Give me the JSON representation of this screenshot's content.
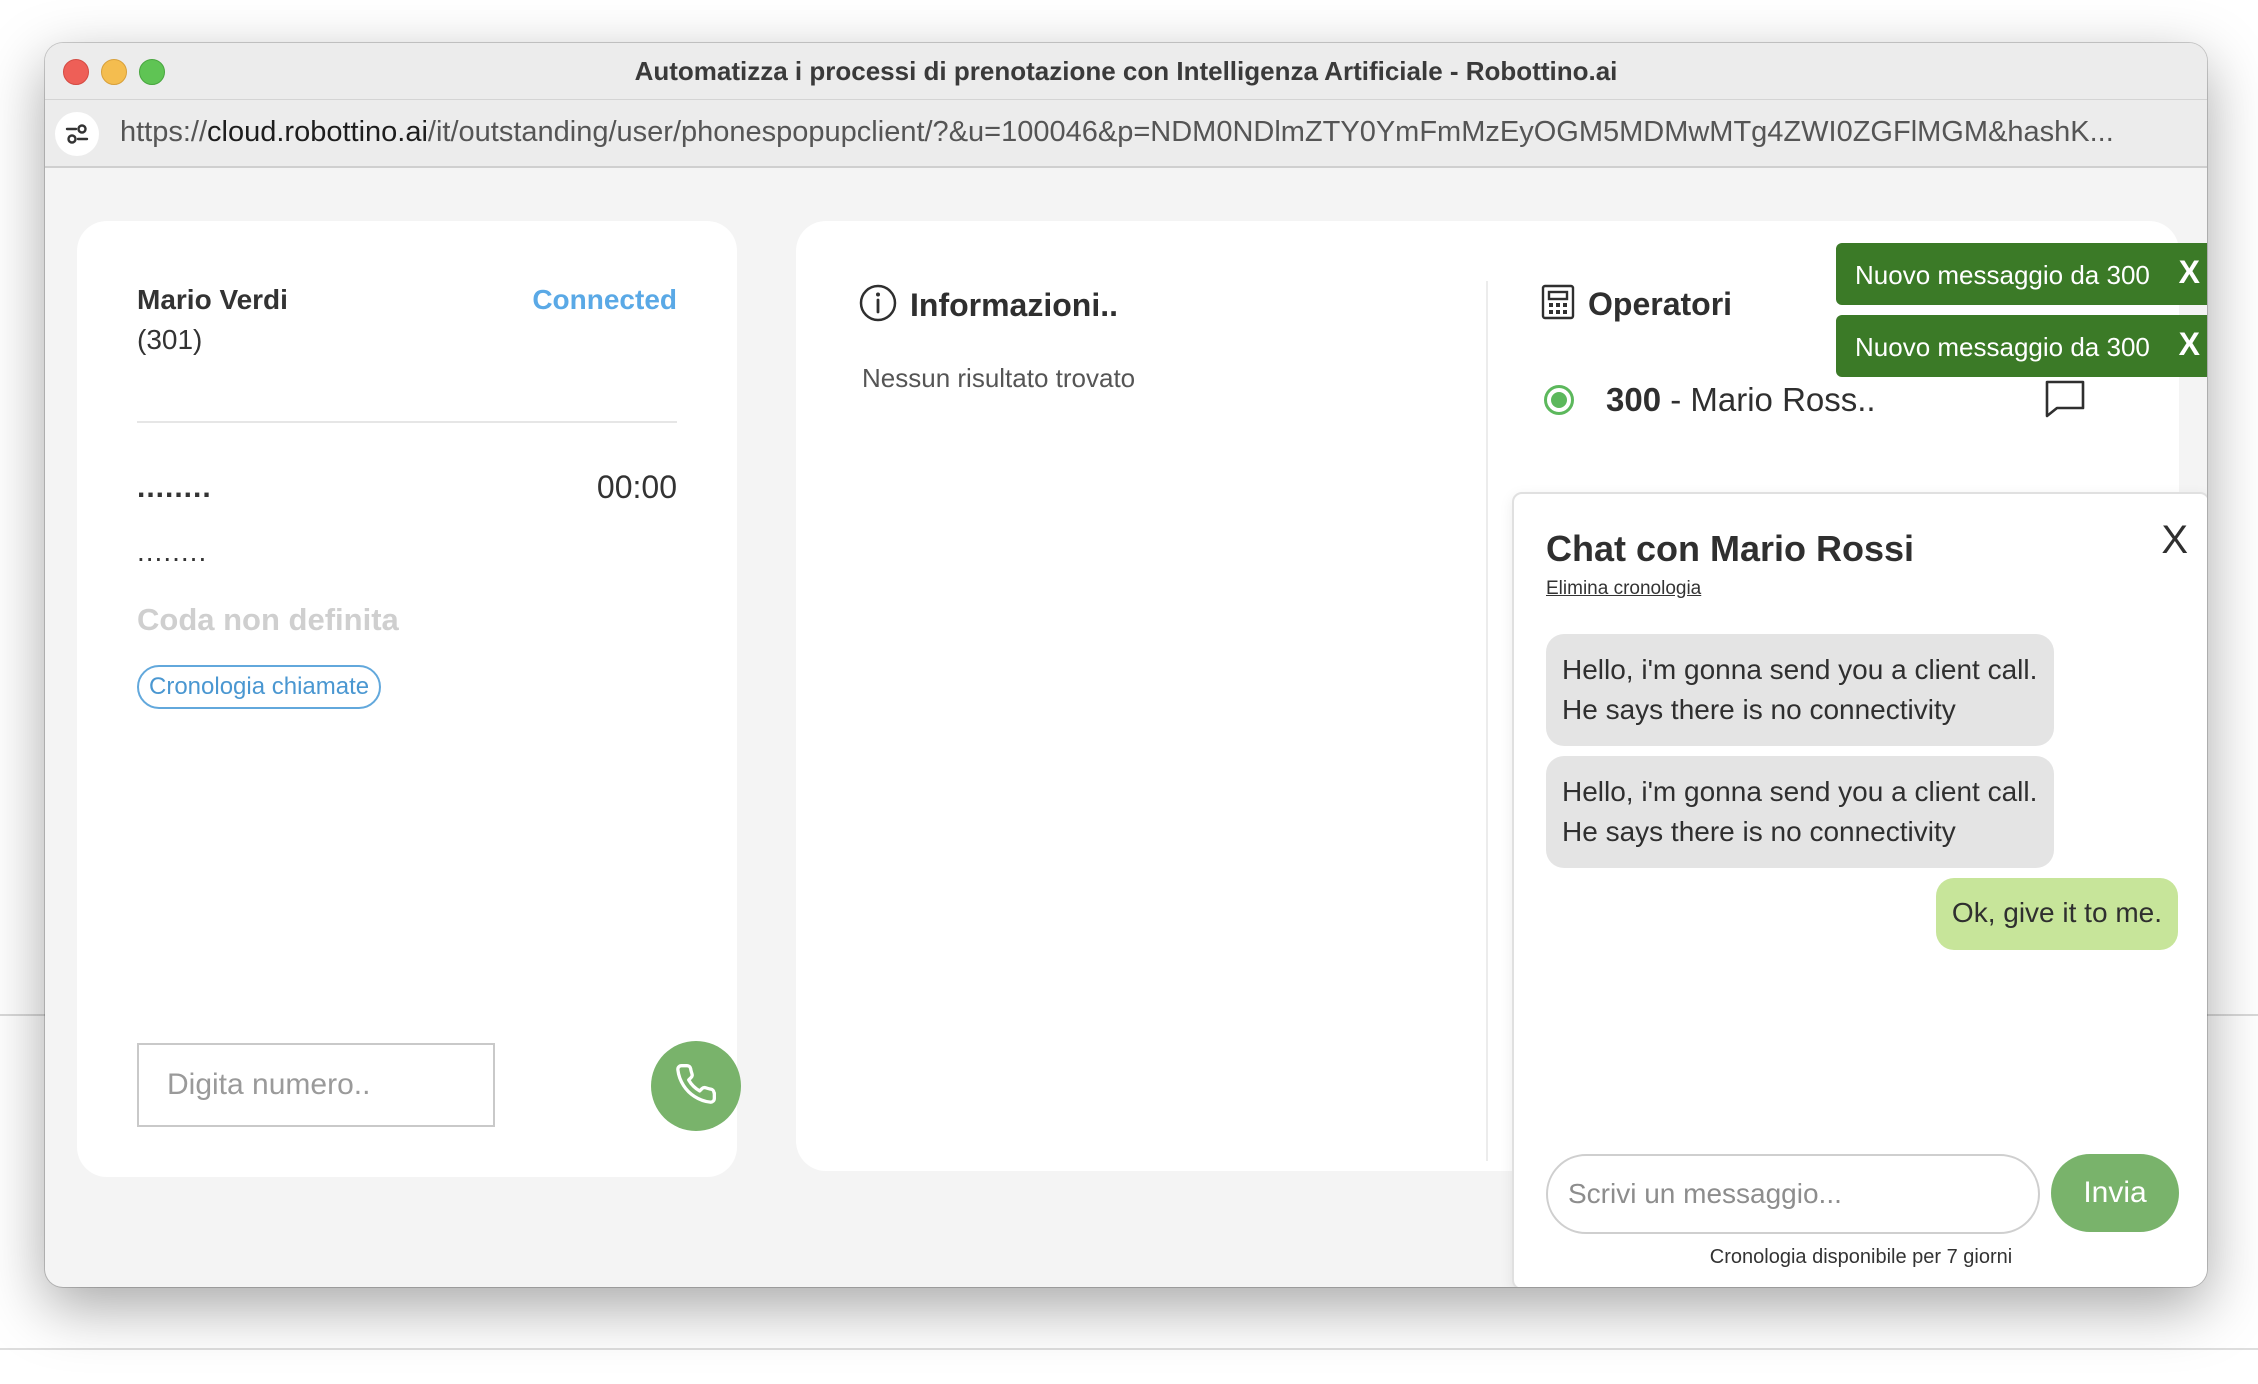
{
  "window": {
    "title": "Automatizza i processi di prenotazione con Intelligenza Artificiale - Robottino.ai"
  },
  "urlbar": {
    "prefix": "https://",
    "host": "cloud.robottino.ai",
    "path": "/it/outstanding/user/phonespopupclient/?&u=100046&p=NDM0NDlmZTY0YmFmMzEyOGM5MDMwMTg4ZWI0ZGFlMGM&hashK..."
  },
  "caller": {
    "name": "Mario Verdi",
    "extension": "(301)",
    "status": "Connected",
    "status_color": "#5aa9e6",
    "number_masked": "........",
    "timer": "00:00",
    "secondary_masked": "........",
    "queue": "Coda non definita",
    "history_button": "Cronologia chiamate",
    "dial_placeholder": "Digita numero.."
  },
  "info": {
    "title": "Informazioni..",
    "empty": "Nessun risultato trovato"
  },
  "operators": {
    "title": "Operatori",
    "items": [
      {
        "number": "300",
        "name": "- Mario Ross.."
      }
    ]
  },
  "toasts": [
    {
      "message": "Nuovo messaggio da 300",
      "close": "X"
    },
    {
      "message": "Nuovo messaggio da 300",
      "close": "X"
    }
  ],
  "chat": {
    "title": "Chat con Mario Rossi",
    "clear_link": "Elimina cronologia",
    "close": "X",
    "messages": [
      {
        "direction": "in",
        "text": "Hello, i'm gonna send you a client call. He says there is no connectivity"
      },
      {
        "direction": "in",
        "text": "Hello, i'm gonna send you a client call. He says there is no connectivity"
      },
      {
        "direction": "out",
        "text": "Ok, give it to me."
      }
    ],
    "input_placeholder": "Scrivi un messaggio...",
    "send_label": "Invia",
    "note": "Cronologia disponibile per 7 giorni"
  },
  "colors": {
    "accent_green": "#79b36b",
    "toast_green": "#3b7a27",
    "outgoing_bubble": "#c7e59a",
    "incoming_bubble": "#e4e4e4"
  }
}
